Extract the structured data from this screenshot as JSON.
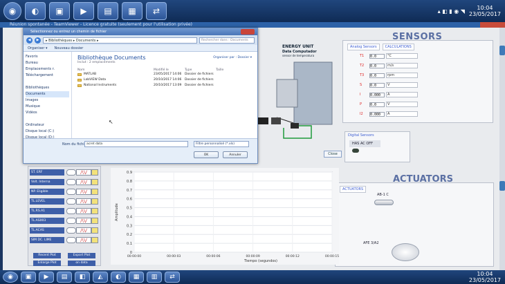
{
  "taskbar_top": {
    "apps": [
      "chrome-icon",
      "folder-icon",
      "media-icon",
      "office-icon",
      "word-icon",
      "teamviewer-icon"
    ],
    "clock_time": "10:04",
    "clock_date": "23/05/2017"
  },
  "teamviewer": {
    "title": "Réunion spontanée - TeamViewer - Licence gratuite (seulement pour l'utilisation privée)"
  },
  "dialog": {
    "title": "Sélectionnez ou entrez un chemin de fichier",
    "address": "▸ Bibliothèques ▸ Documents ▸",
    "search_placeholder": "Rechercher dans : Documents",
    "toolbar": {
      "organize": "Organiser ▾",
      "new_folder": "Nouveau dossier"
    },
    "nav": [
      "Favoris",
      "Bureau",
      "Emplacements r.",
      "Téléchargement",
      "",
      "Bibliothèques",
      "Documents",
      "Images",
      "Musique",
      "Vidéos",
      "",
      "Ordinateur",
      "Disque local (C:)",
      "Disque local (D:)"
    ],
    "library_title": "Bibliothèque Documents",
    "library_subtitle": "Inclut : 2 emplacements",
    "arrange_by": "Organiser par : Dossier ▾",
    "columns": [
      "Nom",
      "Modifié le",
      "Type",
      "Taille"
    ],
    "files": [
      {
        "name": "MATLAB",
        "date": "23/05/2017 14:06",
        "type": "Dossier de fichiers"
      },
      {
        "name": "LabVIEW Data",
        "date": "20/10/2017 14:06",
        "type": "Dossier de fichiers"
      },
      {
        "name": "National Instruments",
        "date": "20/10/2017 13:09",
        "type": "Dossier de fichiers"
      }
    ],
    "filename_label": "Nom du fichier :",
    "filename_value": "acret data",
    "filter_value": "Filtre personnalisé (*.xls)",
    "ok_label": "OK",
    "cancel_label": "Annuler"
  },
  "schematic": {
    "title": "ENERGY UNIT",
    "subtitle": "Data Computador",
    "line3": "sensor de temperatura"
  },
  "sensors": {
    "title": "SENSORS",
    "tabs": [
      "Analog Sensors",
      "CALCULATIONS"
    ],
    "rows": [
      {
        "label": "T1",
        "value": "0.0",
        "unit": "°C"
      },
      {
        "label": "T2",
        "value": "0.0",
        "unit": "m/s"
      },
      {
        "label": "T3",
        "value": "0.0",
        "unit": "rpm"
      },
      {
        "label": "S",
        "value": "0.0",
        "unit": "V"
      },
      {
        "label": "I",
        "value": "0.000",
        "unit": "A"
      },
      {
        "label": "P",
        "value": "0.0",
        "unit": "V"
      },
      {
        "label": "I2",
        "value": "0.000",
        "unit": "A"
      }
    ],
    "digital_label": "Digital Sensors",
    "digital_item": "HAS AC OFF"
  },
  "actuators": {
    "title": "ACTUATORS",
    "tab": "ACTUATORS",
    "switch_label": "AB-1 C",
    "knob_label": "AFE 3/A2"
  },
  "controls": {
    "rows": [
      "ST. ERF",
      "Volt. Interna",
      "NP. Eligible",
      "TL.LEVEL",
      "TL.RS.A1",
      "TL.AS003",
      "TL.ACAS",
      "SIM DC. LIME"
    ],
    "btn_a": "Recent Plot",
    "btn_b": "Export Plot",
    "btn_c": "Enlarge Plot",
    "btn_d": "on data"
  },
  "chart_data": {
    "type": "line",
    "ylabel": "Amplitude",
    "xlabel": "Tiempo (segundos)",
    "y_ticks": [
      "0.9",
      "0.8",
      "0.7",
      "0.6",
      "0.5",
      "0.4",
      "0.3",
      "0.2",
      "0.1",
      "0"
    ],
    "x_ticks": [
      "00:00:00",
      "00:00:03",
      "00:00:06",
      "00:00:09",
      "00:00:12",
      "00:00:15"
    ],
    "ylim": [
      0,
      1
    ],
    "series": [
      {
        "values": []
      }
    ]
  },
  "taskbar_bottom": {
    "clock_time": "10:04",
    "clock_date": "23/05/2017"
  }
}
